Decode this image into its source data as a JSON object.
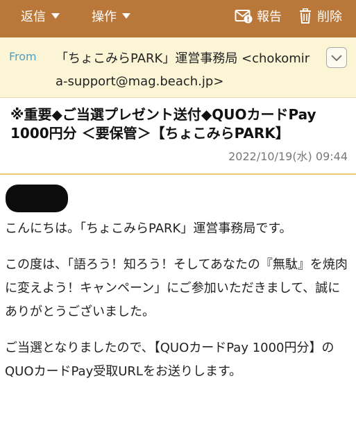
{
  "toolbar": {
    "reply_label": "返信",
    "action_label": "操作",
    "report_label": "報告",
    "delete_label": "削除"
  },
  "header": {
    "from_label": "From",
    "from_value": "「ちょこみらPARK」運営事務局 <chokomira-support@mag.beach.jp>"
  },
  "message": {
    "subject": "※重要◆ご当選プレゼント送付◆QUOカードPay 1000円分 ＜要保管＞【ちょこみらPARK】",
    "date": "2022/10/19(水) 09:44",
    "body": [
      "こんにちは。「ちょこみらPARK」運営事務局です。",
      "この度は、「語ろう！知ろう！そしてあなたの『無駄』を焼肉に変えよう！キャンペーン」にご参加いただきまして、誠にありがとうございました。",
      "ご当選となりましたので、【QUOカードPay 1000円分】のQUOカードPay受取URLをお送りします。"
    ]
  },
  "colors": {
    "toolbar_bg": "#b9783a",
    "from_bg": "#fbf5d6",
    "from_label": "#4f9fc4",
    "separator": "#ecc96b"
  },
  "icons": [
    "chevron-down-icon",
    "report-mail-icon",
    "trash-icon",
    "expand-chevron-icon"
  ]
}
